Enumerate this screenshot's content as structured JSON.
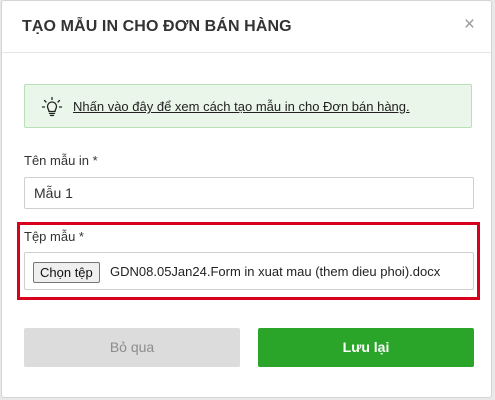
{
  "dialog": {
    "title": "TẠO MẪU IN CHO ĐƠN BÁN HÀNG",
    "close_symbol": "×"
  },
  "hint": {
    "icon": "lightbulb-icon",
    "link_text": "Nhấn vào đây để xem cách tạo mẫu in cho Đơn bán hàng."
  },
  "form": {
    "name_label": "Tên mẫu in *",
    "name_value": "Mẫu 1",
    "file_label": "Tệp mẫu *",
    "file_button_label": "Chọn tệp",
    "file_name": "GDN08.05Jan24.Form in xuat mau (them dieu phoi).docx"
  },
  "actions": {
    "cancel_label": "Bỏ qua",
    "save_label": "Lưu lại"
  },
  "colors": {
    "highlight": "#d8001c",
    "primary": "#2aa52a",
    "hint_bg": "#eaf6ea"
  }
}
